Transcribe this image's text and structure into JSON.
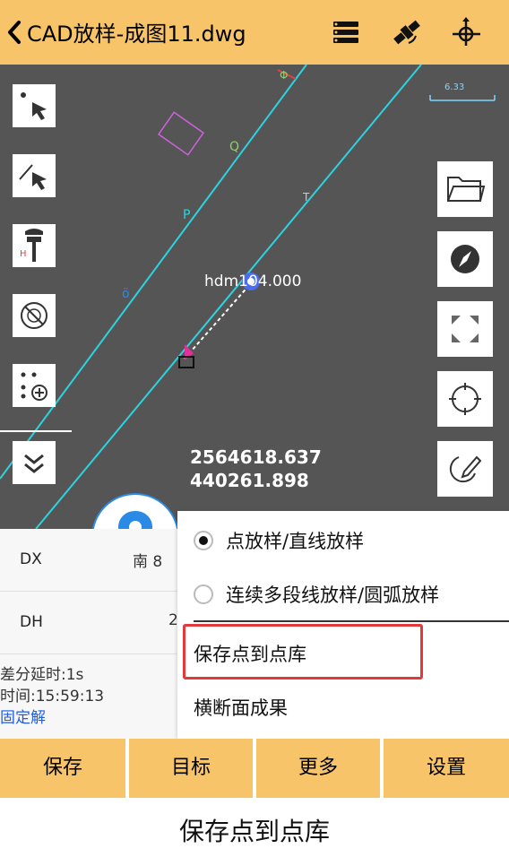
{
  "header": {
    "title": "CAD放样-成图11.dwg",
    "icons": [
      "back-chevron-icon",
      "layers-icon",
      "satellite-icon",
      "crosshair-icon"
    ]
  },
  "map": {
    "scale_label": "6.33",
    "point_label": "hdm104.000",
    "coord_north": "2564618.637",
    "coord_east": "440261.898",
    "colors": {
      "line": "#2bd4e0",
      "background": "#555555"
    }
  },
  "panel": {
    "rows": [
      {
        "key": "DX",
        "value": "南 8"
      },
      {
        "key": "DH",
        "value": "2"
      }
    ],
    "delay": "差分延时:1s",
    "time": "时间:15:59:13",
    "fix": "固定解"
  },
  "menu": {
    "option1": "点放样/直线放样",
    "option2": "连续多段线放样/圆弧放样",
    "item1": "保存点到点库",
    "item2": "横断面成果"
  },
  "bottom": {
    "save": "保存",
    "target": "目标",
    "more": "更多",
    "settings": "设置"
  },
  "caption": "保存点到点库"
}
